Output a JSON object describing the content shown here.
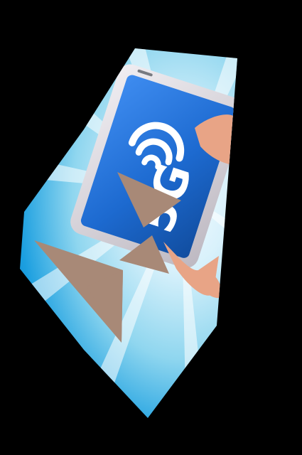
{
  "scene": {
    "background_color": "#000000",
    "burst_colors": [
      "#e7f6fc",
      "#8fd6ef",
      "#1b9fe0",
      "#0c5ea5"
    ],
    "phone_body_color": "#d9d6dd",
    "screen_color": "#1d6ad0",
    "wifi_symbol_color": "#ffffff",
    "overlay_shape_color": "#a88977",
    "hand_color": "#e8a486"
  },
  "phone_screen": {
    "label": "5G"
  }
}
